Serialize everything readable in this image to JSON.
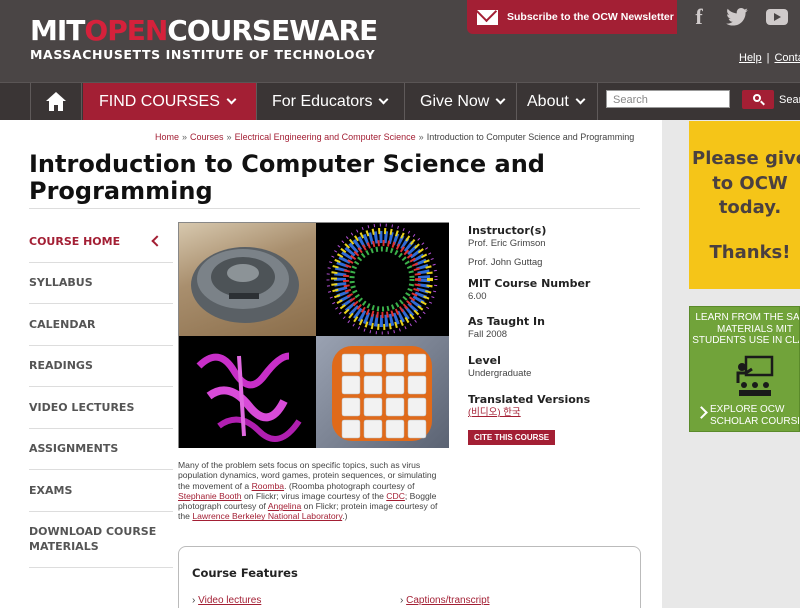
{
  "header": {
    "logo_mit": "MIT",
    "logo_open": "OPEN",
    "logo_courseware": "COURSEWARE",
    "logo_sub": "MASSACHUSETTS INSTITUTE OF TECHNOLOGY",
    "subscribe_label": "Subscribe to the OCW Newsletter",
    "social": {
      "facebook": "f",
      "twitter": "🐦"
    },
    "help_label": "Help",
    "contact_label": "Conta",
    "separator": "|"
  },
  "nav": {
    "find_courses": "FIND COURSES",
    "for_educators": "For Educators",
    "give_now": "Give Now",
    "about": "About",
    "search_placeholder": "Search",
    "search_label": "Sear"
  },
  "breadcrumb": {
    "home": "Home",
    "courses": "Courses",
    "department": "Electrical Engineering and Computer Science",
    "current": "Introduction to Computer Science and Programming",
    "separator": "»"
  },
  "course": {
    "title": "Introduction to Computer Science and Programming"
  },
  "leftnav": {
    "items": [
      "COURSE HOME",
      "SYLLABUS",
      "CALENDAR",
      "READINGS",
      "VIDEO LECTURES",
      "ASSIGNMENTS",
      "EXAMS",
      "DOWNLOAD COURSE MATERIALS"
    ]
  },
  "caption": {
    "p1": "Many of the problem sets focus on specific topics, such as virus population dynamics, word games, protein sequences, or simulating the movement of a ",
    "roomba": "Roomba",
    "p2": ". (Roomba photograph courtesy of ",
    "stephanie": "Stephanie Booth",
    "p3": " on Flickr; virus image courtesy of the ",
    "cdc": "CDC",
    "p4": "; Boggle photograph courtesy of ",
    "angelina": "Angelina",
    "p5": " on Flickr; protein image courtesy of the ",
    "lbnl": "Lawrence Berkeley National Laboratory",
    "p6": ".)"
  },
  "info": {
    "instructors_label": "Instructor(s)",
    "instructor1": "Prof. Eric Grimson",
    "instructor2": "Prof. John Guttag",
    "number_label": "MIT Course Number",
    "number": "6.00",
    "taught_label": "As Taught In",
    "taught": "Fall 2008",
    "level_label": "Level",
    "level": "Undergraduate",
    "translated_label": "Translated Versions",
    "translated": "(비디오) 한국",
    "cite_label": "CITE THIS COURSE"
  },
  "features": {
    "title": "Course Features",
    "marker": "›",
    "link1": "Video lectures",
    "link2": "Captions/transcript"
  },
  "sidebar": {
    "promo_text": "Please give to OCW today.",
    "promo_thanks": "Thanks!",
    "learn_text": "LEARN FROM THE SAME MATERIALS MIT STUDENTS USE IN CLASS",
    "explore_text": "EXPLORE OCW SCHOLAR COURSES"
  },
  "colors": {
    "brand_red": "#a31f34",
    "header_bg": "#4a4545",
    "promo_yellow": "#f5c518",
    "green": "#71a33a"
  }
}
